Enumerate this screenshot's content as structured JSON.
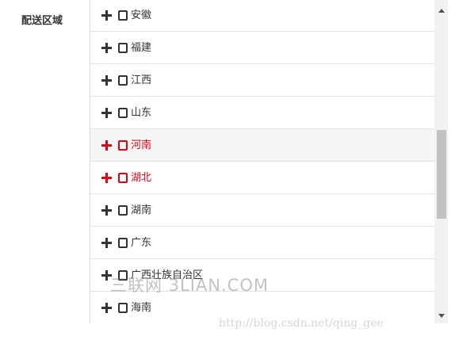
{
  "form": {
    "label": "配送区域"
  },
  "region_list": {
    "items": [
      {
        "name": "安徽",
        "state": "normal"
      },
      {
        "name": "福建",
        "state": "normal"
      },
      {
        "name": "江西",
        "state": "normal"
      },
      {
        "name": "山东",
        "state": "normal"
      },
      {
        "name": "河南",
        "state": "hover-active"
      },
      {
        "name": "湖北",
        "state": "active"
      },
      {
        "name": "湖南",
        "state": "normal"
      },
      {
        "name": "广东",
        "state": "normal"
      },
      {
        "name": "广西壮族自治区",
        "state": "normal"
      },
      {
        "name": "海南",
        "state": "normal"
      }
    ],
    "active_color": "#e60012",
    "text_color": "#333333"
  },
  "watermarks": {
    "site": "三联网 3LIAN.COM",
    "url": "http://blog.csdn.net/qing_gee"
  }
}
